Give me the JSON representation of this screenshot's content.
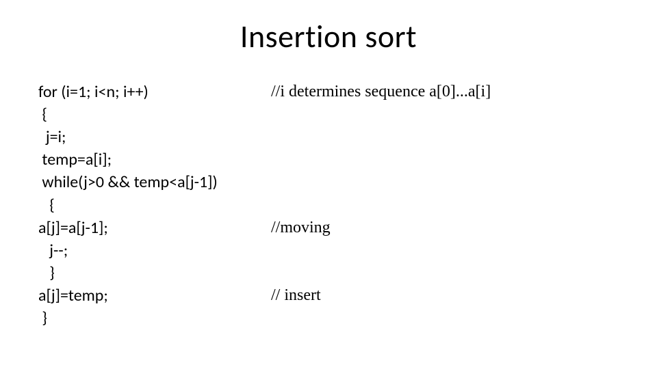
{
  "title": "Insertion sort",
  "rows": [
    {
      "code": "for (i=1; i<n; i++)",
      "comment": "//i determines sequence a[0]...a[i]"
    },
    {
      "code": " {",
      "comment": ""
    },
    {
      "code": "  j=i;",
      "comment": ""
    },
    {
      "code": " temp=a[i];",
      "comment": ""
    },
    {
      "code": " while(j>0 && temp<a[j-1])",
      "comment": ""
    },
    {
      "code": "   {",
      "comment": ""
    },
    {
      "code": "a[j]=a[j-1];",
      "comment": "//moving"
    },
    {
      "code": "   j--;",
      "comment": ""
    },
    {
      "code": "   }",
      "comment": ""
    },
    {
      "code": "a[j]=temp;",
      "comment": "// insert"
    },
    {
      "code": " }",
      "comment": ""
    }
  ]
}
